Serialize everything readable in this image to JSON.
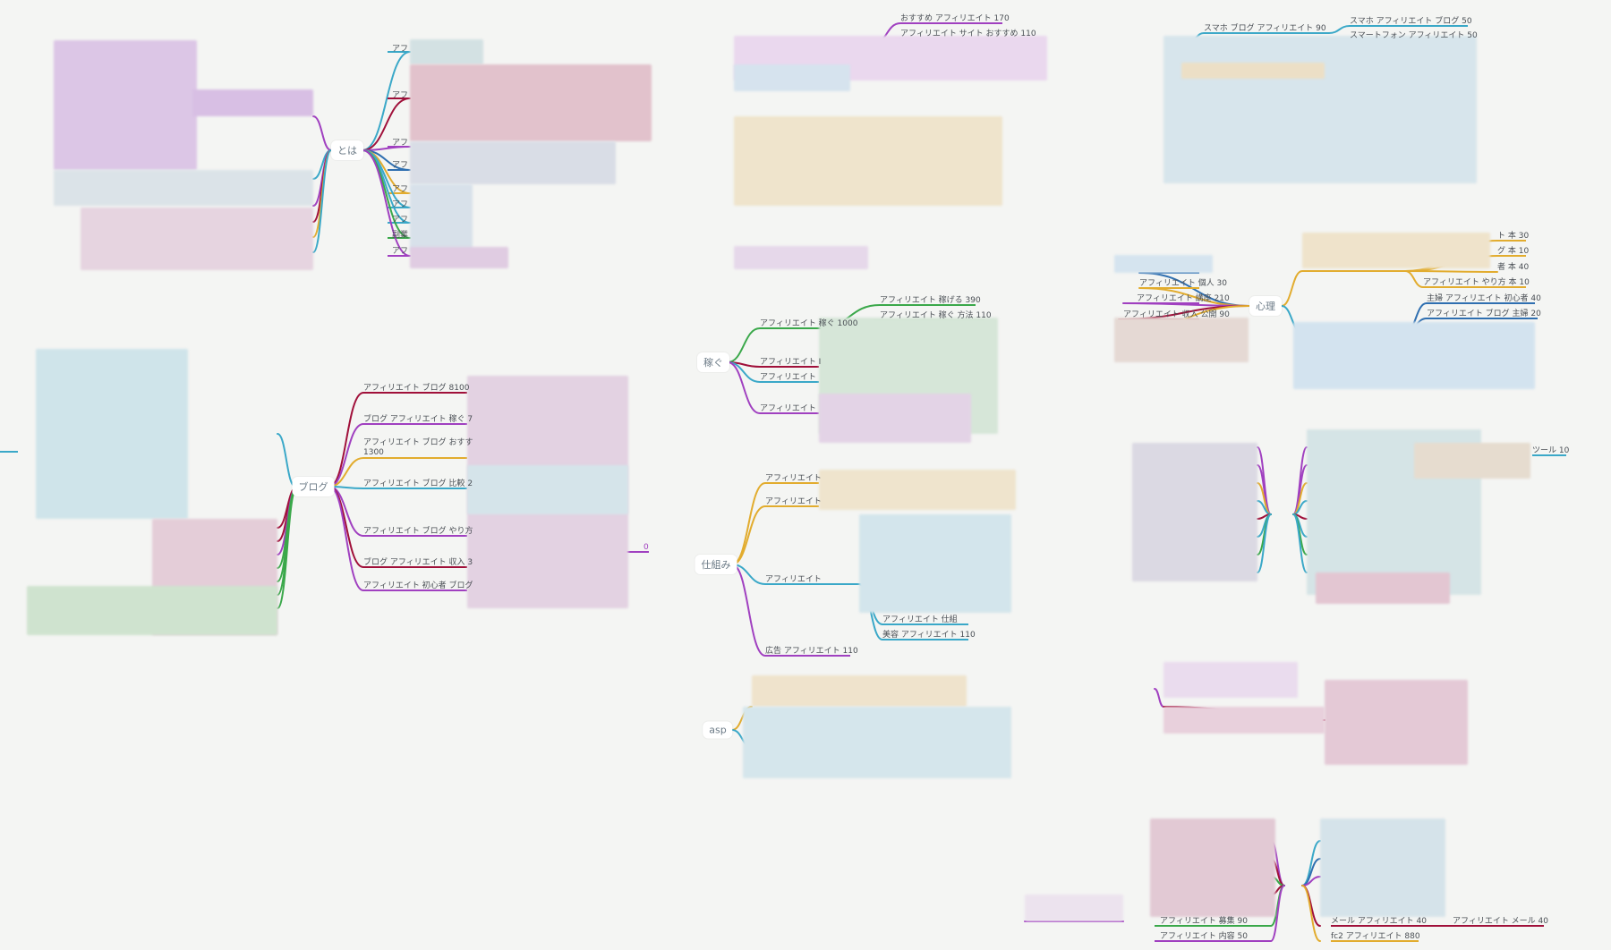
{
  "colors": {
    "purple": "#a040c0",
    "teal": "#3aa8c8",
    "maroon": "#a0103a",
    "gold": "#e2ac2e",
    "green": "#3aa84a",
    "blue": "#2f6fb0",
    "background": "#f4f5f3"
  },
  "hubs": {
    "towa": "とは",
    "blog": "ブログ",
    "kasegu": "稼ぐ",
    "shikumi": "仕組み",
    "asp": "asp",
    "shinri": "心理"
  },
  "labels": {
    "towa_1": "アフ",
    "towa_2": "アフ",
    "towa_3": "アフ",
    "towa_4": "アフ",
    "towa_5": "アフ",
    "towa_6": "アフ",
    "towa_7": "アフ",
    "towa_8": "副業",
    "towa_9": "アフ",
    "top_1": "おすすめ アフィリエイト 170",
    "top_2": "アフィリエイト サイト おすすめ 110",
    "tr_1": "スマホ ブログ アフィリエイト 90",
    "tr_2": "スマホ アフィリエイト ブログ 50",
    "tr_3": "スマートフォン アフィリエイト 50",
    "blog_1": "アフィリエイト ブログ 8100",
    "blog_2": "ブログ アフィリエイト 稼ぐ 7",
    "blog_3": "アフィリエイト ブログ おすす",
    "blog_3b": "1300",
    "blog_4": "アフィリエイト ブログ 比較 2",
    "blog_5": "アフィリエイト ブログ やり方",
    "blog_6": "ブログ アフィリエイト 収入 3",
    "blog_7": "アフィリエイト 初心者 ブログ",
    "blog_end": "0",
    "kasegu_1": "アフィリエイト 稼ぐ 1000",
    "kasegu_1a": "アフィリエイト 稼げる 390",
    "kasegu_1b": "アフィリエイト 稼ぐ 方法 110",
    "kasegu_2": "アフィリエイト I",
    "kasegu_3": "アフィリエイト ",
    "kasegu_4": "アフィリエイト ",
    "shikumi_1": "アフィリエイト",
    "shikumi_2": "アフィリエイト",
    "shikumi_3": "アフィリエイト",
    "shikumi_3b": "アフィリエイト 仕組",
    "shikumi_3c": "美容 アフィリエイト 110",
    "shikumi_4": "広告 アフィリエイト 110",
    "shinri_l1": "アフィリエイト 個人 30",
    "shinri_l2": "アフィリエイト 講座 210",
    "shinri_l3": "アフィリエイト 収入 公開 90",
    "shinri_r1": "ト 本 30",
    "shinri_r2": "グ 本 10",
    "shinri_r3": "者 本 40",
    "shinri_r4": "アフィリエイト やり方 本 10",
    "shinri_r5": "主婦 アフィリエイト 初心者 40",
    "shinri_r6": "アフィリエイト ブログ 主婦 20",
    "tool": "ツール 10",
    "bot_1": "アフィリエイト 募集 90",
    "bot_2": "アフィリエイト 内容 50",
    "bot_3": "メール アフィリエイト 40",
    "bot_4": "アフィリエイト メール 40",
    "bot_5": "fc2 アフィリエイト 880"
  }
}
